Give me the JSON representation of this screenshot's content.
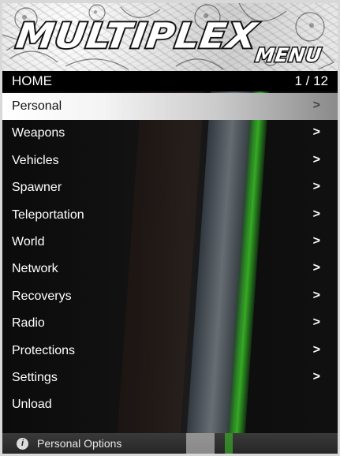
{
  "banner": {
    "title": "MULTIPLEX",
    "subtitle": "MENU"
  },
  "titlebar": {
    "menu_name": "HOME",
    "position": "1 / 12"
  },
  "menu": {
    "items": [
      {
        "label": "Personal",
        "arrow": ">",
        "selected": true
      },
      {
        "label": "Weapons",
        "arrow": ">"
      },
      {
        "label": "Vehicles",
        "arrow": ">"
      },
      {
        "label": "Spawner",
        "arrow": ">"
      },
      {
        "label": "Teleportation",
        "arrow": ">"
      },
      {
        "label": "World",
        "arrow": ">"
      },
      {
        "label": "Network",
        "arrow": ">"
      },
      {
        "label": "Recoverys",
        "arrow": ">"
      },
      {
        "label": "Radio",
        "arrow": ">"
      },
      {
        "label": "Protections",
        "arrow": ">"
      },
      {
        "label": "Settings",
        "arrow": ">"
      },
      {
        "label": "Unload",
        "arrow": ""
      }
    ]
  },
  "footer": {
    "icon": "info-icon",
    "icon_glyph": "i",
    "description": "Personal Options"
  },
  "colors": {
    "selected_bg": "#ffffff",
    "text": "#ffffff",
    "footer_bg": "#2e2e2e"
  }
}
